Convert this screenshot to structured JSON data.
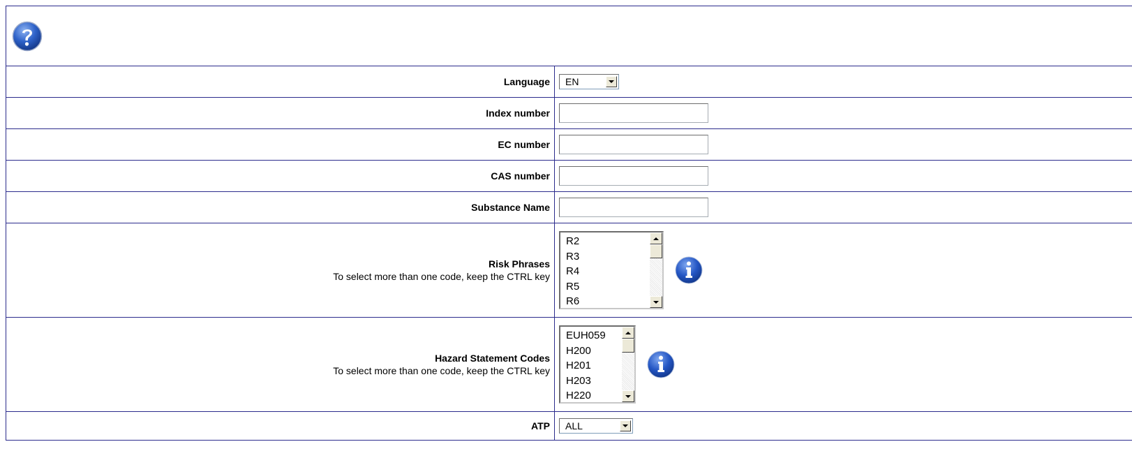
{
  "header": {
    "help_icon": "question-mark-icon"
  },
  "fields": {
    "language": {
      "label": "Language",
      "value": "EN"
    },
    "index_number": {
      "label": "Index number",
      "value": ""
    },
    "ec_number": {
      "label": "EC number",
      "value": ""
    },
    "cas_number": {
      "label": "CAS number",
      "value": ""
    },
    "substance_name": {
      "label": "Substance Name",
      "value": ""
    },
    "risk_phrases": {
      "label": "Risk Phrases",
      "hint": "To select more than one code, keep the CTRL key",
      "options": [
        "R2",
        "R3",
        "R4",
        "R5",
        "R6"
      ],
      "info_icon": "info-icon"
    },
    "hazard_statement_codes": {
      "label": "Hazard Statement Codes",
      "hint": "To select more than one code, keep the CTRL key",
      "options": [
        "EUH059",
        "H200",
        "H201",
        "H203",
        "H220"
      ],
      "info_icon": "info-icon"
    },
    "atp": {
      "label": "ATP",
      "value": "ALL"
    }
  },
  "colors": {
    "border": "#2b2b8c",
    "icon_blue": "#2456c4"
  }
}
